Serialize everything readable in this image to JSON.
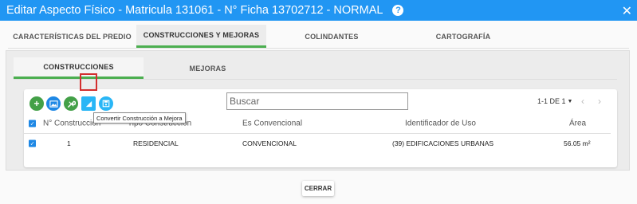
{
  "dialog": {
    "title": "Editar Aspecto Físico - Matricula 131061 - N° Ficha 13702712 - NORMAL",
    "help_symbol": "?",
    "close_symbol": "✕"
  },
  "main_tabs": [
    {
      "label": "CARACTERÍSTICAS DEL PREDIO"
    },
    {
      "label": "CONSTRUCCIONES Y MEJORAS"
    },
    {
      "label": "COLINDANTES"
    },
    {
      "label": "CARTOGRAFÍA"
    }
  ],
  "sub_tabs": [
    {
      "label": "CONSTRUCCIONES"
    },
    {
      "label": "MEJORAS"
    }
  ],
  "toolbar": {
    "add_symbol": "+",
    "tooltip": "Convertir Construcción a Mejora"
  },
  "search": {
    "placeholder": "Buscar"
  },
  "pagination": {
    "label": "1-1 DE 1",
    "prev": "‹",
    "next": "›"
  },
  "table": {
    "headers": [
      "N° Construcción",
      "Tipo Construcción",
      "Es Convencional",
      "Identificador de Uso",
      "Área"
    ],
    "rows": [
      [
        "1",
        "RESIDENCIAL",
        "CONVENCIONAL",
        "(39) EDIFICACIONES URBANAS",
        "56.05 m²"
      ]
    ]
  },
  "footer": {
    "close_label": "CERRAR"
  },
  "colors": {
    "titlebar": "#2196f3",
    "active_tab_indicator": "#4caf50",
    "highlight": "#d32f2f"
  }
}
